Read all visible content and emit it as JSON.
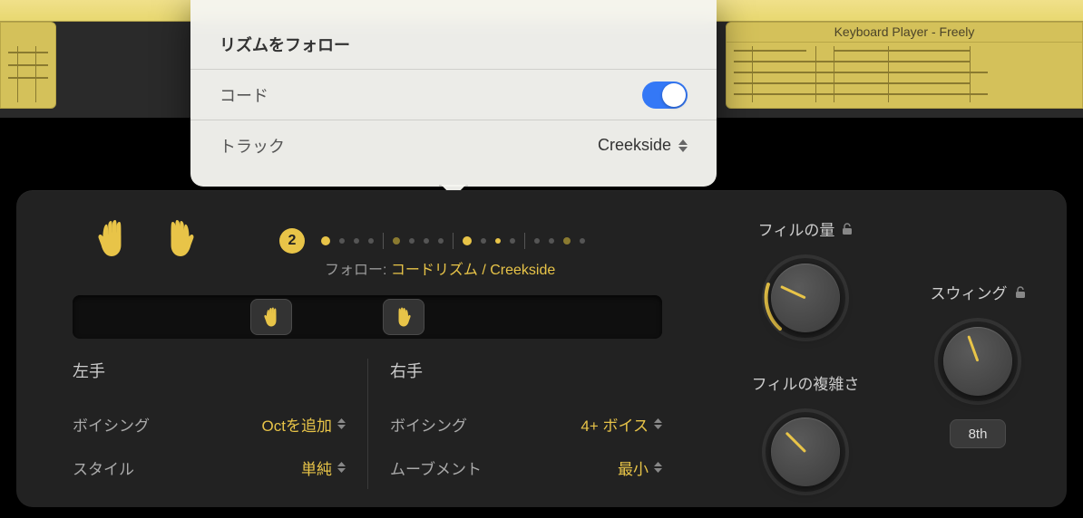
{
  "track": {
    "region_title": "Keyboard Player - Freely"
  },
  "popover": {
    "section_title": "リズムをフォロー",
    "chord_label": "コード",
    "chord_on": true,
    "track_label": "トラック",
    "track_value": "Creekside"
  },
  "hands_row": {
    "beat_number": "2",
    "follow_label": "フォロー:",
    "follow_value": "コードリズム / Creekside"
  },
  "left_hand": {
    "title": "左手",
    "voicing_label": "ボイシング",
    "voicing_value": "Octを追加",
    "style_label": "スタイル",
    "style_value": "単純"
  },
  "right_hand": {
    "title": "右手",
    "voicing_label": "ボイシング",
    "voicing_value": "4+ ボイス",
    "movement_label": "ムーブメント",
    "movement_value": "最小"
  },
  "knobs": {
    "fill_amount_label": "フィルの量",
    "fill_complexity_label": "フィルの複雑さ",
    "swing_label": "スウィング",
    "swing_mode": "8th"
  },
  "icons": {
    "hand": "hand-icon",
    "lock": "unlock-icon",
    "chevrons": "stepper-icon"
  }
}
